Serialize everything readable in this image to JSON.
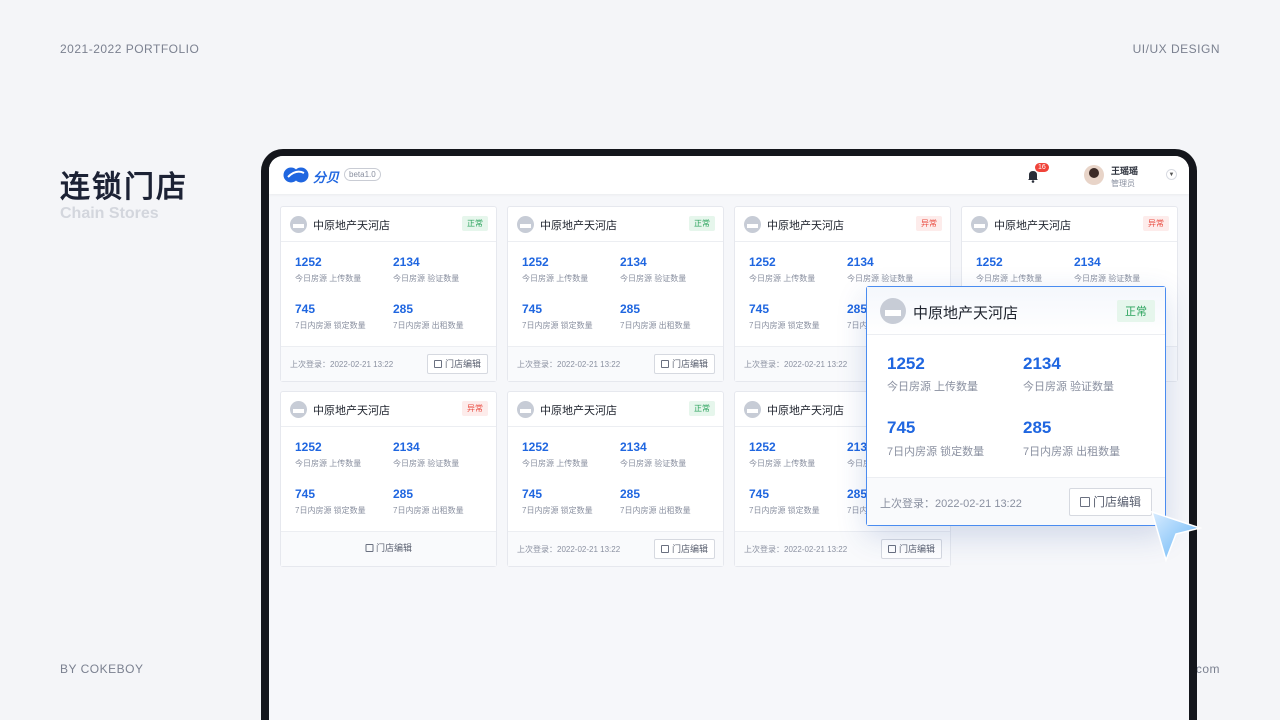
{
  "slide": {
    "top_left": "2021-2022 PORTFOLIO",
    "top_right": "UI/UX DESIGN",
    "bottom_left": "BY COKEBOY",
    "bottom_right": "com",
    "title_zh": "连锁门店",
    "title_en": "Chain Stores"
  },
  "app": {
    "logo_text": "分贝",
    "version": "beta1.0",
    "notifications": "16",
    "user_name": "王瑶瑶",
    "user_role": "管理员",
    "accent_color": "#1f66e0"
  },
  "stats_labels": {
    "upload": "今日房源 上传数量",
    "verify": "今日房源 验证数量",
    "lock": "7日内房源 锁定数量",
    "rent": "7日内房源 出租数量"
  },
  "cards": [
    {
      "name": "中原地产天河店",
      "status": "正常",
      "upload": "1252",
      "verify": "2134",
      "lock": "745",
      "rent": "285",
      "last_login": "上次登录：2022-02-21 13:22",
      "edit": "门店编辑"
    },
    {
      "name": "中原地产天河店",
      "status": "正常",
      "upload": "1252",
      "verify": "2134",
      "lock": "745",
      "rent": "285",
      "last_login": "上次登录：2022-02-21 13:22",
      "edit": "门店编辑"
    },
    {
      "name": "中原地产天河店",
      "status": "异常",
      "upload": "1252",
      "verify": "2134",
      "lock": "745",
      "rent": "285",
      "last_login": "上次登录：2022-02-21 13:22",
      "edit": "门店编辑"
    },
    {
      "name": "中原地产天河店",
      "status": "异常",
      "upload": "1252",
      "verify": "2134",
      "lock": "",
      "rent": "",
      "last_login": "",
      "edit": ""
    },
    {
      "name": "中原地产天河店",
      "status": "异常",
      "upload": "1252",
      "verify": "2134",
      "lock": "745",
      "rent": "285",
      "last_login": "",
      "edit": "门店编辑"
    },
    {
      "name": "中原地产天河店",
      "status": "正常",
      "upload": "1252",
      "verify": "2134",
      "lock": "745",
      "rent": "285",
      "last_login": "上次登录：2022-02-21 13:22",
      "edit": "门店编辑"
    },
    {
      "name": "中原地产天河店",
      "status": "",
      "upload": "1252",
      "verify": "213",
      "lock": "745",
      "rent": "285",
      "last_login": "上次登录：2022-02-21 13:22",
      "edit": "门店编辑"
    }
  ],
  "popup": {
    "name": "中原地产天河店",
    "status": "正常",
    "upload": "1252",
    "verify": "2134",
    "lock": "745",
    "rent": "285",
    "last_login": "上次登录：2022-02-21 13:22",
    "edit": "门店编辑"
  }
}
